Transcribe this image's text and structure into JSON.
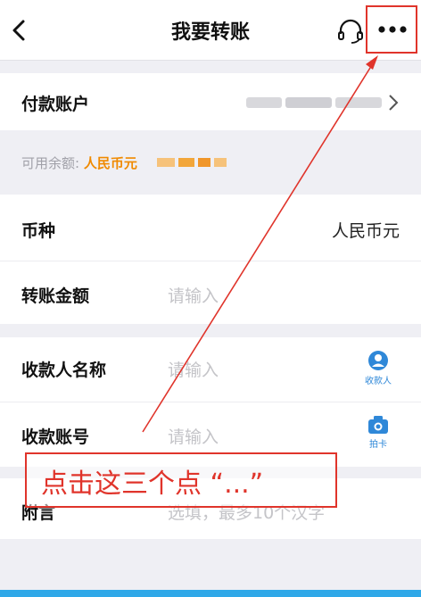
{
  "header": {
    "title": "我要转账",
    "back_icon": "chevron-left-icon",
    "service_icon": "headset-icon",
    "more_icon": "more-dots-icon"
  },
  "pay_account": {
    "label": "付款账户",
    "masked_value_icon": "masked-account-placeholder"
  },
  "balance": {
    "label": "可用余额:",
    "currency": "人民币元"
  },
  "currency_field": {
    "label": "币种",
    "value": "人民币元"
  },
  "amount_field": {
    "label": "转账金额",
    "placeholder": "请输入"
  },
  "payee_name_field": {
    "label": "收款人名称",
    "placeholder": "请输入",
    "action_label": "收款人"
  },
  "payee_account_field": {
    "label": "收款账号",
    "placeholder": "请输入",
    "action_label": "拍卡"
  },
  "memo_field": {
    "label": "附言",
    "placeholder": "选填，最多10个汉字"
  },
  "annotation": {
    "text": "点击这三个点 “...”"
  },
  "colors": {
    "accent_blue": "#2f88d8",
    "annotation_red": "#e0342b",
    "balance_orange": "#f08a00",
    "background": "#efeff4"
  }
}
